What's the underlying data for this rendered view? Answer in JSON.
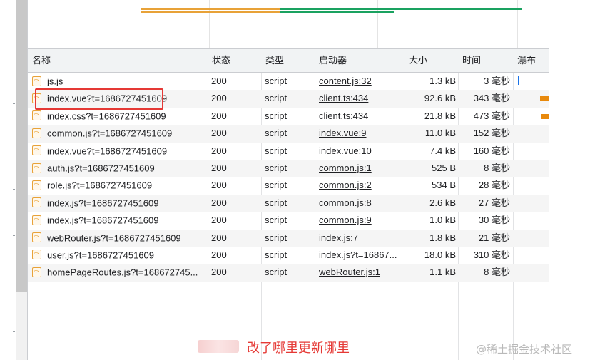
{
  "columns": {
    "name": "名称",
    "status": "状态",
    "type": "类型",
    "initiator": "启动器",
    "size": "大小",
    "time": "时间",
    "waterfall": "瀑布"
  },
  "rows": [
    {
      "name": "js.js",
      "status": "200",
      "type": "script",
      "initiator": "content.js:32",
      "size": "1.3 kB",
      "time": "3 毫秒"
    },
    {
      "name": "index.vue?t=1686727451609",
      "status": "200",
      "type": "script",
      "initiator": "client.ts:434",
      "size": "92.6 kB",
      "time": "343 毫秒"
    },
    {
      "name": "index.css?t=1686727451609",
      "status": "200",
      "type": "script",
      "initiator": "client.ts:434",
      "size": "21.8 kB",
      "time": "473 毫秒"
    },
    {
      "name": "common.js?t=1686727451609",
      "status": "200",
      "type": "script",
      "initiator": "index.vue:9",
      "size": "11.0 kB",
      "time": "152 毫秒"
    },
    {
      "name": "index.vue?t=1686727451609",
      "status": "200",
      "type": "script",
      "initiator": "index.vue:10",
      "size": "7.4 kB",
      "time": "160 毫秒"
    },
    {
      "name": "auth.js?t=1686727451609",
      "status": "200",
      "type": "script",
      "initiator": "common.js:1",
      "size": "525 B",
      "time": "8 毫秒"
    },
    {
      "name": "role.js?t=1686727451609",
      "status": "200",
      "type": "script",
      "initiator": "common.js:2",
      "size": "534 B",
      "time": "28 毫秒"
    },
    {
      "name": "index.js?t=1686727451609",
      "status": "200",
      "type": "script",
      "initiator": "common.js:8",
      "size": "2.6 kB",
      "time": "27 毫秒"
    },
    {
      "name": "index.js?t=1686727451609",
      "status": "200",
      "type": "script",
      "initiator": "common.js:9",
      "size": "1.0 kB",
      "time": "30 毫秒"
    },
    {
      "name": "webRouter.js?t=1686727451609",
      "status": "200",
      "type": "script",
      "initiator": "index.js:7",
      "size": "1.8 kB",
      "time": "21 毫秒"
    },
    {
      "name": "user.js?t=1686727451609",
      "status": "200",
      "type": "script",
      "initiator": "index.js?t=16867...",
      "size": "18.0 kB",
      "time": "310 毫秒"
    },
    {
      "name": "homePageRoutes.js?t=168672745...",
      "status": "200",
      "type": "script",
      "initiator": "webRouter.js:1",
      "size": "1.1 kB",
      "time": "8 毫秒"
    }
  ],
  "caption": "改了哪里更新哪里",
  "watermark": "@稀土掘金技术社区",
  "colors": {
    "highlight": "#e53935",
    "waterfall_blue": "#1a73e8",
    "waterfall_orange": "#e8890c",
    "overview_green": "#1aa260",
    "header_bg": "#f1f3f4"
  }
}
